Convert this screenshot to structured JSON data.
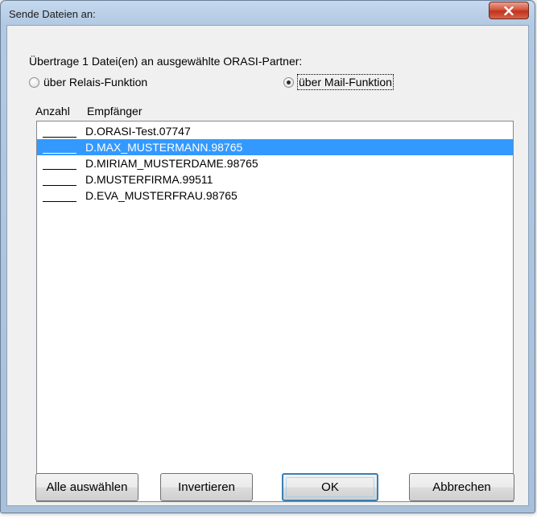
{
  "window": {
    "title": "Sende Dateien an:"
  },
  "dialog": {
    "instruction": "Übertrage 1 Datei(en) an ausgewählte ORASI-Partner:",
    "options": [
      {
        "label": "über Relais-Funktion",
        "selected": false
      },
      {
        "label": "über Mail-Funktion",
        "selected": true
      }
    ],
    "columns": {
      "count": "Anzahl",
      "recipient": "Empfänger"
    },
    "recipients": [
      {
        "name": "D.ORASI-Test.07747",
        "selected": false
      },
      {
        "name": "D.MAX_MUSTERMANN.98765",
        "selected": true
      },
      {
        "name": "D.MIRIAM_MUSTERDAME.98765",
        "selected": false
      },
      {
        "name": "D.MUSTERFIRMA.99511",
        "selected": false
      },
      {
        "name": "D.EVA_MUSTERFRAU.98765",
        "selected": false
      }
    ],
    "buttons": {
      "select_all": "Alle auswählen",
      "invert": "Invertieren",
      "ok": "OK",
      "cancel": "Abbrechen"
    }
  },
  "colors": {
    "selection": "#3399ff",
    "close_button": "#c7402a",
    "frame": "#b2c9e2"
  },
  "icons": {
    "close": "close-icon"
  }
}
